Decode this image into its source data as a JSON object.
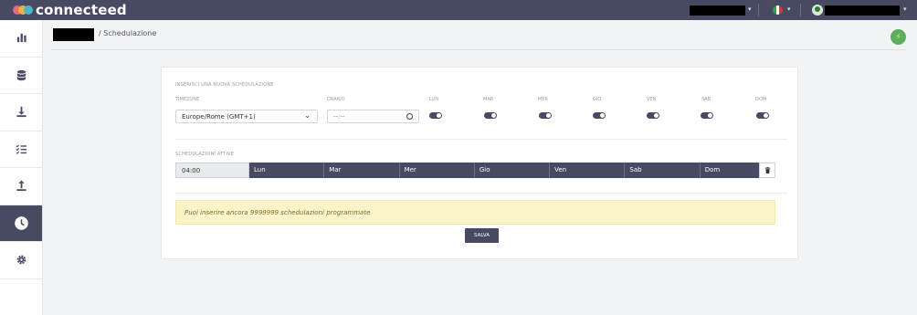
{
  "app": {
    "brand": "connecteed"
  },
  "breadcrumb": {
    "separator": "/",
    "current": "Schedulazione"
  },
  "form": {
    "section_title": "INSERISCI UNA NUOVA SCHEDULAZIONE",
    "timezone_label": "TIMEZONE",
    "timezone_value": "Europe/Rome (GMT+1)",
    "time_label": "ORARIO",
    "time_placeholder": "--:--",
    "days": [
      {
        "label": "LUN",
        "enabled": true
      },
      {
        "label": "MAR",
        "enabled": true
      },
      {
        "label": "MER",
        "enabled": true
      },
      {
        "label": "GIO",
        "enabled": true
      },
      {
        "label": "VEN",
        "enabled": true
      },
      {
        "label": "SAB",
        "enabled": true
      },
      {
        "label": "DOM",
        "enabled": true
      }
    ]
  },
  "active": {
    "section_title": "SCHEDULAZIONI ATTIVE",
    "rows": [
      {
        "time": "04:00",
        "days": [
          "Lun",
          "Mar",
          "Mer",
          "Gio",
          "Ven",
          "Sab",
          "Dom"
        ]
      }
    ]
  },
  "alert": {
    "text": "Puoi inserire ancora 9999999 schedulazioni programmate"
  },
  "actions": {
    "save_label": "SALVA"
  },
  "colors": {
    "topbar": "#484a64",
    "accent": "#484a64",
    "alert_bg": "#fcf4c9",
    "bolt_bg": "#5cae5f"
  },
  "icons": {
    "sidebar": [
      "bar-chart-icon",
      "database-icon",
      "download-icon",
      "checklist-icon",
      "upload-icon",
      "clock-icon",
      "gear-icon"
    ],
    "header": [
      "flag-italy-icon",
      "avatar-icon",
      "lightning-icon"
    ]
  }
}
